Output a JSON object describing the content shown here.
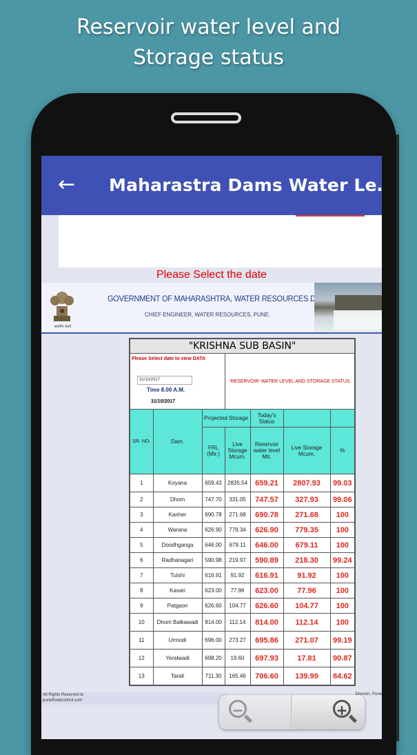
{
  "promo": {
    "line1": "Reservoir water level and",
    "line2": "Storage status"
  },
  "app": {
    "title": "Maharastra Dams Water Le…",
    "back_icon": "arrow-back-icon",
    "date_prompt": "Please Select the date",
    "colors": {
      "appbar": "#3f51b5",
      "accent_red": "#e0261d",
      "header_cyan": "#5ce7d9"
    }
  },
  "banner": {
    "line1": "GOVERNMENT OF MAHARASHTRA, WATER RESOURCES DEPARTMENT",
    "line2": "CHIEF ENGINEER, WATER RESOURCES, PUNE.",
    "emblem_caption": "सत्यमेव जयते"
  },
  "table": {
    "basin_title": "\"KRISHNA SUB BASIN\"",
    "select_label": "Please Select date to view DATA",
    "date_input_value": "31/10/2017",
    "time_label": "Time 8.00  A.M.",
    "date_label": "31/10/2017",
    "status_title": "'RESERVOIR' WATER LEVEL AND STORAGE STATUS",
    "headers": {
      "sr_no": "SR. NO.",
      "dam": "Dam.",
      "projected_storage": "Projected Storage",
      "todays_status": "Today's Status",
      "frl": "FRL (Mtr.)",
      "live_storage": "Live Storage Mcum.",
      "reservoir_level": "Reservoir water level Mtr.",
      "live_storage_today": "Live Storage Mcum.",
      "percent": "%"
    },
    "rows": [
      {
        "sr": "1",
        "dam": "Koyana",
        "frl": "659.43",
        "live": "2835.54",
        "level": "659.21",
        "storage": "2807.93",
        "pct": "99.03"
      },
      {
        "sr": "2",
        "dam": "Dhom",
        "frl": "747.70",
        "live": "331.05",
        "level": "747.57",
        "storage": "327.93",
        "pct": "99.06"
      },
      {
        "sr": "3",
        "dam": "Kanher",
        "frl": "690.78",
        "live": "271.68",
        "level": "690.78",
        "storage": "271.68",
        "pct": "100"
      },
      {
        "sr": "4",
        "dam": "Warana",
        "frl": "626.90",
        "live": "779.34",
        "level": "626.90",
        "storage": "779.35",
        "pct": "100"
      },
      {
        "sr": "5",
        "dam": "Doodhganga",
        "frl": "646.00",
        "live": "679.11",
        "level": "646.00",
        "storage": "679.11",
        "pct": "100"
      },
      {
        "sr": "6",
        "dam": "Radhanagari",
        "frl": "590.98",
        "live": "219.97",
        "level": "590.89",
        "storage": "218.30",
        "pct": "99.24"
      },
      {
        "sr": "7",
        "dam": "Tulshi",
        "frl": "616.91",
        "live": "91.92",
        "level": "616.91",
        "storage": "91.92",
        "pct": "100"
      },
      {
        "sr": "8",
        "dam": "Kasari",
        "frl": "623.00",
        "live": "77.96",
        "level": "623.00",
        "storage": "77.96",
        "pct": "100"
      },
      {
        "sr": "9",
        "dam": "Patgaon",
        "frl": "626.60",
        "live": "104.77",
        "level": "626.60",
        "storage": "104.77",
        "pct": "100"
      },
      {
        "sr": "10",
        "dam": "Dhom Balkawadi",
        "frl": "814.00",
        "live": "112.14",
        "level": "814.00",
        "storage": "112.14",
        "pct": "100"
      },
      {
        "sr": "11",
        "dam": "Urmodi",
        "frl": "696.00",
        "live": "273.27",
        "level": "695.86",
        "storage": "271.07",
        "pct": "99.19"
      },
      {
        "sr": "12",
        "dam": "Yeralwadi",
        "frl": "698.20",
        "live": "19.60",
        "level": "697.93",
        "storage": "17.81",
        "pct": "90.87"
      },
      {
        "sr": "13",
        "dam": "Tarali",
        "frl": "711.30",
        "live": "165.46",
        "level": "706.60",
        "storage": "139.99",
        "pct": "84.62"
      }
    ]
  },
  "footer": {
    "left_line1": "All Rights Reserved to",
    "left_line2": "punefloodcontrol.com",
    "right_text": "Division, Pune"
  },
  "zoom": {
    "out_symbol": "−",
    "in_symbol": "+",
    "out_icon": "zoom-out-icon",
    "in_icon": "zoom-in-icon"
  }
}
